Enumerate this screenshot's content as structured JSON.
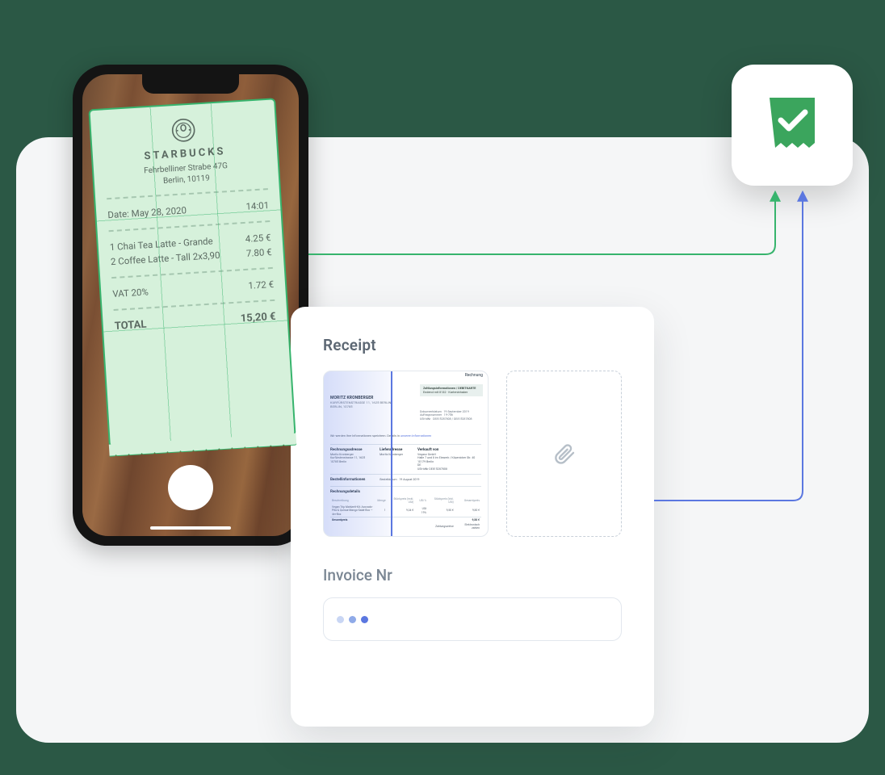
{
  "receipt_scan": {
    "merchant": "STARBUCKS",
    "address_line1": "Fehrbelliner Strabe 47G",
    "address_line2": "Berlin, 10119",
    "date_label": "Date:",
    "date_value": "May 28, 2020",
    "time": "14:01",
    "items": [
      {
        "desc": "1 Chai Tea Latte - Grande",
        "price": "4.25 €"
      },
      {
        "desc": "2 Coffee Latte - Tall 2x3,90",
        "price": "7.80 €"
      }
    ],
    "vat_label": "VAT 20%",
    "vat_value": "1.72 €",
    "total_label": "TOTAL",
    "total_value": "15,20 €"
  },
  "form": {
    "section_title": "Receipt",
    "invoice_label": "Invoice Nr"
  },
  "mini_invoice": {
    "doc_label": "Rechnung",
    "bill_to_name": "MORITZ KRONBERGER",
    "bill_to_street": "KURFÜRSTENSTRASSE 11, 1625 BERLIN",
    "bill_to_city": "BERLIN, 10785",
    "meta_heading": "Zahlungsinformationen / DEBITKARTE",
    "meta_sub": "Endend mit 8132 · Karteninhaber",
    "doc_date_label": "Dokumentdatum",
    "doc_date": "19 September 2019",
    "doc_nr_label": "Auftragsnummer",
    "doc_nr": "19-756",
    "ust_label": "USt-IdNr",
    "ust": "DE815287808 / DE815287808",
    "intro_prefix": "Wir werden Ihre Informationen speichern. Details in",
    "intro_link": "unseren Informationen",
    "billing_heading": "Rechnungsadresse",
    "billing_name": "Moritz Kronberger",
    "billing_street": "Kurfürstenstrasse 11, 1625",
    "billing_city": "10785 Berlin",
    "delivery_heading": "Lieferadresse",
    "delivery_name": "Moritz Kronberger",
    "sold_by_heading": "Verkauft von",
    "sold_by_l1": "Veganz GmbH",
    "sold_by_l2": "Halle 7 und 8 im Eiswerk / Köpenicker Str. 40",
    "sold_by_l3": "10179 Berlin",
    "sold_by_l4": "DE",
    "sold_by_ust": "USt-IdNr  DE815287808",
    "order_heading": "Bestellinformationen",
    "order_date_label": "Bestelldatum",
    "order_date": "19 August 2019",
    "details_heading": "Rechnungsdetails",
    "columns": [
      "Beschreibung",
      "Menge",
      "Stückpreis (exkl. USt)",
      "USt %",
      "Stückpreis (inkl. USt)",
      "Gesamtpreis"
    ],
    "line_desc": "Vegan Trip Mahlzeit-Kit: Avocado-Pita & Quinoa-Mango-Salat-Box — 4er-Box",
    "line_qty": "1",
    "line_unit_ex": "9,34 €",
    "line_vat": "USt 19%",
    "line_unit_in": "9,50 €",
    "line_total": "9,50 €",
    "grand_label": "Gesamtpreis",
    "grand_value": "9,50 €",
    "payment_note_l": "Zahlungsweise",
    "payment_note_r": "Elektronisch zahlen"
  },
  "colors": {
    "green": "#37b46d",
    "blue": "#5b77e0"
  }
}
